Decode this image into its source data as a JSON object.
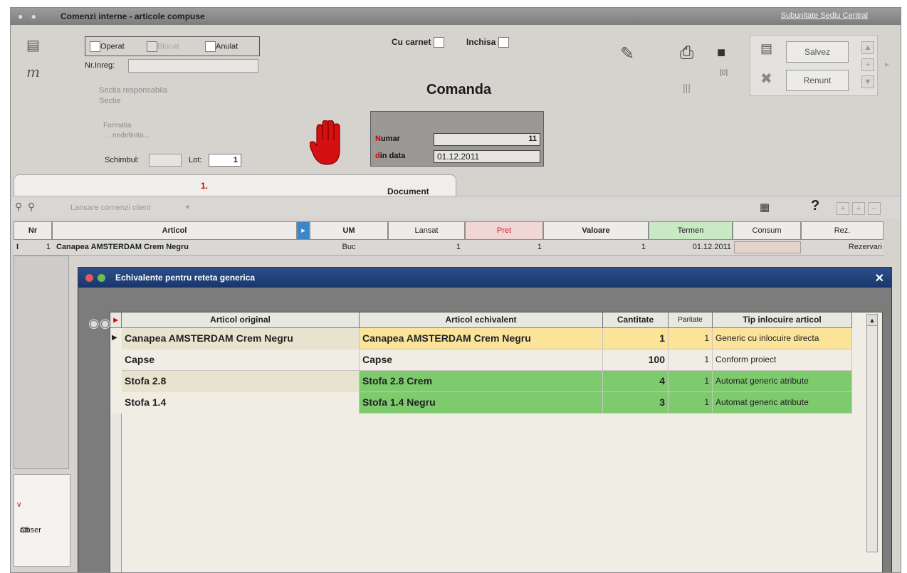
{
  "window": {
    "title": "Comenzi interne - articole compuse",
    "subunit": "Subunitate Sediu Central"
  },
  "header": {
    "operat_label": "Operat",
    "blocat_label": "Blocat",
    "anulat_label": "Anulat",
    "nrinreg_label": "Nr.Inreg:",
    "sectia_label": "Sectia responsabila",
    "sectie_label": "Sectie",
    "formatia_label": "Formatia",
    "formatia_value": "... nedefinita...",
    "schimbul_label": "Schimbul:",
    "lot_label": "Lot:",
    "lot_value": "1",
    "cu_carnet_label": "Cu carnet",
    "inchisa_label": "Inchisa",
    "doc_title": "Comanda",
    "numar_first": "N",
    "numar_rest": "umar",
    "numar_value": "11",
    "din_first": "d",
    "din_rest": "in data",
    "din_value": "01.12.2011",
    "printer_count": "[0]"
  },
  "buttons": {
    "save": "Salvez",
    "cancel": "Renunt"
  },
  "tab": {
    "number": "1.",
    "label": "Document"
  },
  "toolbar": {
    "lansare_label": "Lansare comenzi client"
  },
  "grid": {
    "columns": [
      "Nr",
      "Articol",
      "UM",
      "Lansat",
      "Pret",
      "Valoare",
      "Termen",
      "Consum",
      "Rez."
    ],
    "row": {
      "nr": "1",
      "articol": "Canapea AMSTERDAM Crem Negru",
      "um": "Buc",
      "lansat": "1",
      "pret": "1",
      "valoare": "1",
      "termen": "01.12.2011",
      "rez": "Rezervari"
    }
  },
  "observatii": {
    "before": "Obser",
    "highlight": "v",
    "after": "atii"
  },
  "modal": {
    "title": "Echivalente pentru reteta generica",
    "columns": [
      "Articol original",
      "Articol echivalent",
      "Cantitate",
      "Paritate",
      "Tip inlocuire articol"
    ],
    "rows": [
      {
        "original": "Canapea AMSTERDAM Crem Negru",
        "echivalent": "Canapea AMSTERDAM Crem Negru",
        "cantitate": "1",
        "paritate": "1",
        "tip": "Generic cu inlocuire directa"
      },
      {
        "original": "Capse",
        "echivalent": "Capse",
        "cantitate": "100",
        "paritate": "1",
        "tip": "Conform proiect"
      },
      {
        "original": "Stofa 2.8",
        "echivalent": "Stofa 2.8 Crem",
        "cantitate": "4",
        "paritate": "1",
        "tip": "Automat generic atribute"
      },
      {
        "original": "Stofa 1.4",
        "echivalent": "Stofa 1.4 Negru",
        "cantitate": "3",
        "paritate": "1",
        "tip": "Automat generic atribute"
      }
    ]
  },
  "colors": {
    "row_yellow": "#fbe39a",
    "row_green": "#7ecb6e",
    "accent_red": "#d40000",
    "title_blue": "#1c3a70"
  }
}
